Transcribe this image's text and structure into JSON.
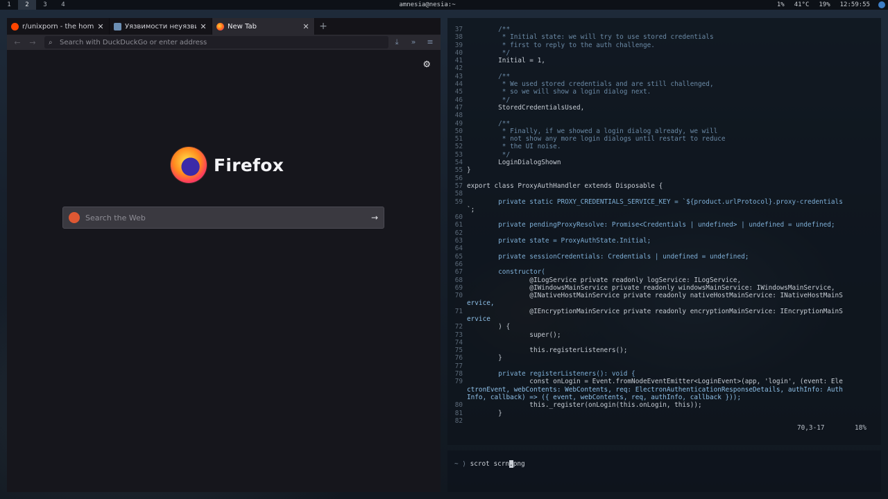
{
  "topbar": {
    "workspaces": [
      "1",
      "2",
      "3",
      "4"
    ],
    "title": "amnesia@nesia:~",
    "status": [
      "1%",
      "41°C",
      "19%",
      "12:59:55"
    ]
  },
  "firefox": {
    "tabs": [
      {
        "title": "r/unixporn - the home for",
        "favicon": "reddit-icon"
      },
      {
        "title": "Уязвимости неуязвимог",
        "favicon": "page-icon"
      },
      {
        "title": "New Tab",
        "favicon": "firefox-icon"
      }
    ],
    "url_placeholder": "Search with DuckDuckGo or enter address",
    "brand": "Firefox",
    "search_placeholder": "Search the Web"
  },
  "vim": {
    "lines": [
      {
        "n": "37",
        "t": "        /**",
        "c": "cmt"
      },
      {
        "n": "38",
        "t": "         * Initial state: we will try to use stored credentials",
        "c": "cmt"
      },
      {
        "n": "39",
        "t": "         * first to reply to the auth challenge.",
        "c": "cmt"
      },
      {
        "n": "40",
        "t": "         */",
        "c": "cmt"
      },
      {
        "n": "41",
        "t": "        Initial = 1,",
        "c": ""
      },
      {
        "n": "42",
        "t": "",
        "c": ""
      },
      {
        "n": "43",
        "t": "        /**",
        "c": "cmt"
      },
      {
        "n": "44",
        "t": "         * We used stored credentials and are still challenged,",
        "c": "cmt"
      },
      {
        "n": "45",
        "t": "         * so we will show a login dialog next.",
        "c": "cmt"
      },
      {
        "n": "46",
        "t": "         */",
        "c": "cmt"
      },
      {
        "n": "47",
        "t": "        StoredCredentialsUsed,",
        "c": ""
      },
      {
        "n": "48",
        "t": "",
        "c": ""
      },
      {
        "n": "49",
        "t": "        /**",
        "c": "cmt"
      },
      {
        "n": "50",
        "t": "         * Finally, if we showed a login dialog already, we will",
        "c": "cmt"
      },
      {
        "n": "51",
        "t": "         * not show any more login dialogs until restart to reduce",
        "c": "cmt"
      },
      {
        "n": "52",
        "t": "         * the UI noise.",
        "c": "cmt"
      },
      {
        "n": "53",
        "t": "         */",
        "c": "cmt"
      },
      {
        "n": "54",
        "t": "        LoginDialogShown",
        "c": ""
      },
      {
        "n": "55",
        "t": "}",
        "c": ""
      },
      {
        "n": "56",
        "t": "",
        "c": ""
      },
      {
        "n": "57",
        "t": "export class ProxyAuthHandler extends Disposable {",
        "c": ""
      },
      {
        "n": "58",
        "t": "",
        "c": ""
      },
      {
        "n": "59",
        "t": "        private static PROXY_CREDENTIALS_SERVICE_KEY = `${product.urlProtocol}.proxy-credentials",
        "c": "kw"
      },
      {
        "n": "",
        "t": "`;",
        "c": ""
      },
      {
        "n": "60",
        "t": "",
        "c": ""
      },
      {
        "n": "61",
        "t": "        private pendingProxyResolve: Promise<Credentials | undefined> | undefined = undefined;",
        "c": "kw"
      },
      {
        "n": "62",
        "t": "",
        "c": ""
      },
      {
        "n": "63",
        "t": "        private state = ProxyAuthState.Initial;",
        "c": "kw"
      },
      {
        "n": "64",
        "t": "",
        "c": ""
      },
      {
        "n": "65",
        "t": "        private sessionCredentials: Credentials | undefined = undefined;",
        "c": "kw"
      },
      {
        "n": "66",
        "t": "",
        "c": ""
      },
      {
        "n": "67",
        "t": "        constructor(",
        "c": "kw"
      },
      {
        "n": "68",
        "t": "                @ILogService private readonly logService: ILogService,",
        "c": ""
      },
      {
        "n": "69",
        "t": "                @IWindowsMainService private readonly windowsMainService: IWindowsMainService,",
        "c": ""
      },
      {
        "n": "70",
        "t": "                @INativeHostMainService private readonly nativeHostMainService: INativeHostMainS",
        "c": ""
      },
      {
        "n": "",
        "t": "ervice,",
        "c": "wrap"
      },
      {
        "n": "71",
        "t": "                @IEncryptionMainService private readonly encryptionMainService: IEncryptionMainS",
        "c": ""
      },
      {
        "n": "",
        "t": "ervice",
        "c": "wrap"
      },
      {
        "n": "72",
        "t": "        ) {",
        "c": ""
      },
      {
        "n": "73",
        "t": "                super();",
        "c": ""
      },
      {
        "n": "74",
        "t": "",
        "c": ""
      },
      {
        "n": "75",
        "t": "                this.registerListeners();",
        "c": ""
      },
      {
        "n": "76",
        "t": "        }",
        "c": ""
      },
      {
        "n": "77",
        "t": "",
        "c": ""
      },
      {
        "n": "78",
        "t": "        private registerListeners(): void {",
        "c": "kw"
      },
      {
        "n": "79",
        "t": "                const onLogin = Event.fromNodeEventEmitter<LoginEvent>(app, 'login', (event: Ele",
        "c": ""
      },
      {
        "n": "",
        "t": "ctronEvent, webContents: WebContents, req: ElectronAuthenticationResponseDetails, authInfo: Auth",
        "c": "wrap"
      },
      {
        "n": "",
        "t": "Info, callback) => ({ event, webContents, req, authInfo, callback }));",
        "c": "wrap"
      },
      {
        "n": "80",
        "t": "                this._register(onLogin(this.onLogin, this));",
        "c": ""
      },
      {
        "n": "81",
        "t": "        }",
        "c": ""
      },
      {
        "n": "82",
        "t": "",
        "c": ""
      }
    ],
    "ruler": "70,3-17",
    "percent": "18%"
  },
  "terminal": {
    "prompt": "~ ⟩",
    "command_before": "scrot scrn",
    "cursor_char": ".",
    "command_after": "png"
  }
}
